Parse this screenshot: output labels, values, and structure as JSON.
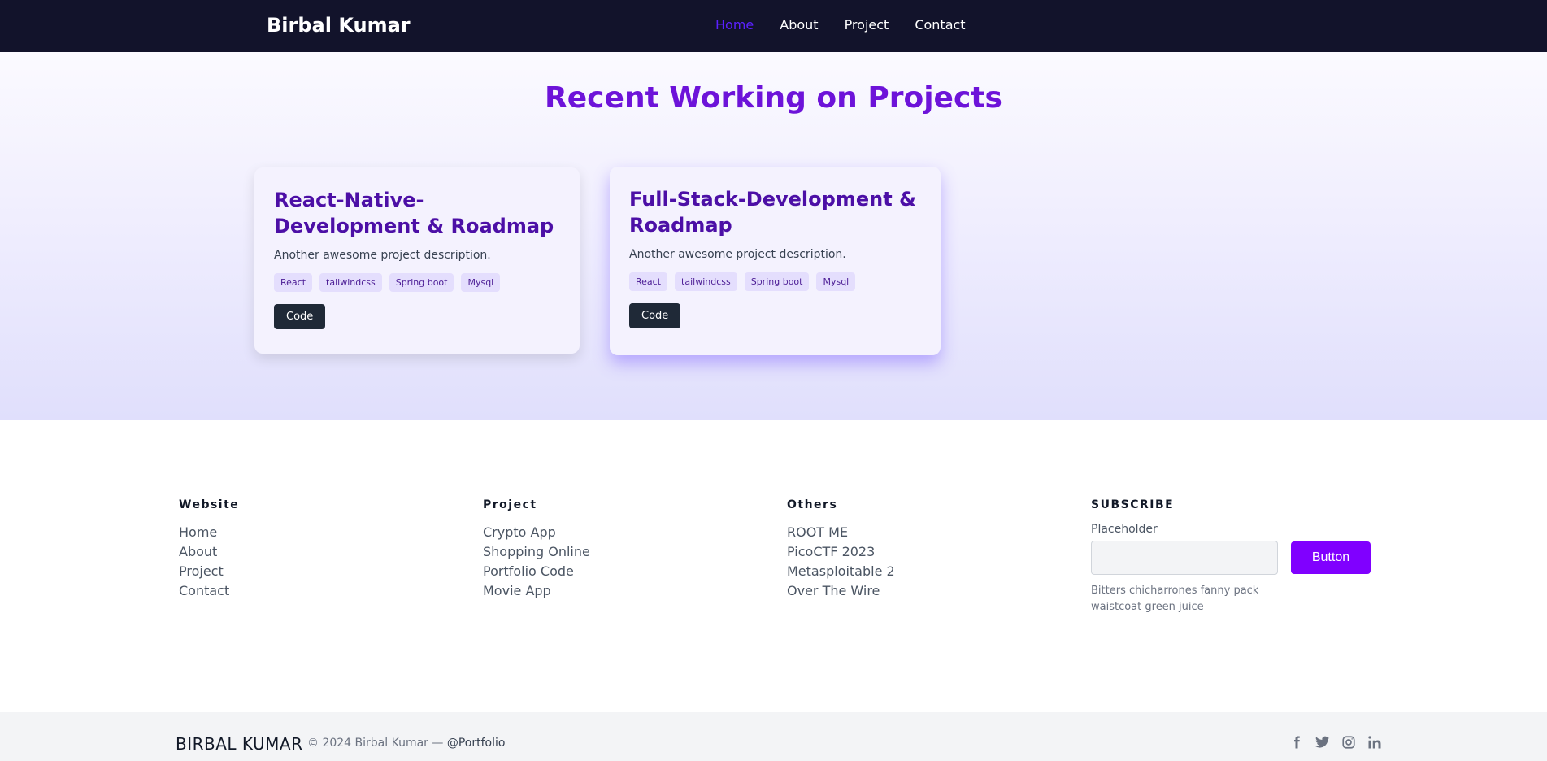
{
  "navbar": {
    "brand": "Birbal Kumar",
    "links": [
      "Home",
      "About",
      "Project",
      "Contact"
    ],
    "active_link": "Home"
  },
  "projects": {
    "title": "Recent Working on Projects",
    "cards": [
      {
        "title": "React-Native-Development & Roadmap",
        "description": "Another awesome project description.",
        "tags": [
          "React",
          "tailwindcss",
          "Spring boot",
          "Mysql"
        ],
        "button": "Code"
      },
      {
        "title": "Full-Stack-Development & Roadmap",
        "description": "Another awesome project description.",
        "tags": [
          "React",
          "tailwindcss",
          "Spring boot",
          "Mysql"
        ],
        "button": "Code"
      }
    ]
  },
  "footer": {
    "columns": [
      {
        "heading": "Website",
        "items": [
          "Home",
          "About",
          "Project",
          "Contact"
        ]
      },
      {
        "heading": "Project",
        "items": [
          "Crypto App",
          "Shopping Online",
          "Portfolio Code",
          "Movie App"
        ]
      },
      {
        "heading": "Others",
        "items": [
          "ROOT ME",
          "PicoCTF 2023",
          "Metasploitable 2",
          "Over The Wire"
        ]
      }
    ],
    "subscribe": {
      "heading": "SUBSCRIBE",
      "label": "Placeholder",
      "input_value": "",
      "button": "Button",
      "note": "Bitters chicharrones fanny pack waistcoat green juice"
    }
  },
  "bottom_bar": {
    "brand": "BIRBAL KUMAR",
    "copyright": "© 2024 Birbal Kumar —",
    "handle": "@Portfolio",
    "socials": [
      "facebook-icon",
      "twitter-icon",
      "instagram-icon",
      "linkedin-icon"
    ]
  },
  "colors": {
    "navbar_bg": "#12132b",
    "accent_purple": "#6d13d9",
    "active_link": "#5b21ff",
    "subscribe_button": "#8000ff",
    "code_button": "#1f2937"
  }
}
